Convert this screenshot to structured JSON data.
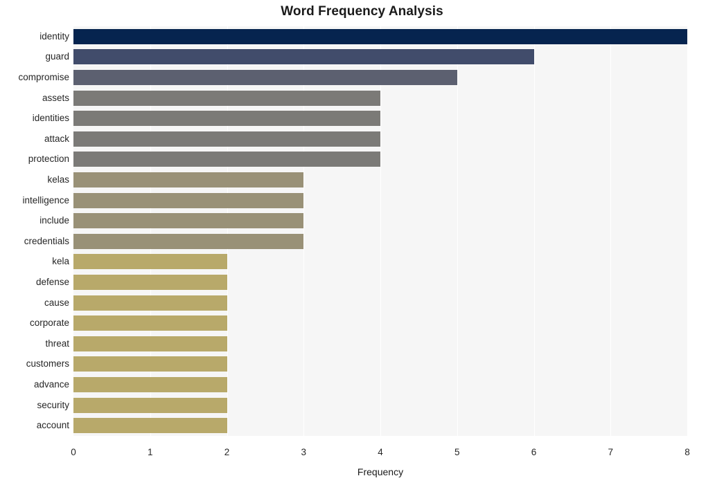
{
  "chart_data": {
    "type": "bar",
    "orientation": "horizontal",
    "title": "Word Frequency Analysis",
    "xlabel": "Frequency",
    "ylabel": "",
    "xlim": [
      0,
      8
    ],
    "ylim": [
      0,
      20
    ],
    "grid": true,
    "legend": null,
    "xticks": [
      "0",
      "1",
      "2",
      "3",
      "4",
      "5",
      "6",
      "7",
      "8"
    ],
    "xtick_values": [
      0,
      1,
      2,
      3,
      4,
      5,
      6,
      7,
      8
    ],
    "categories": [
      "identity",
      "guard",
      "compromise",
      "assets",
      "identities",
      "attack",
      "protection",
      "kelas",
      "intelligence",
      "include",
      "credentials",
      "kela",
      "defense",
      "cause",
      "corporate",
      "threat",
      "customers",
      "advance",
      "security",
      "account"
    ],
    "values": [
      8,
      6,
      5,
      4,
      4,
      4,
      4,
      3,
      3,
      3,
      3,
      2,
      2,
      2,
      2,
      2,
      2,
      2,
      2,
      2
    ],
    "bar_colors": [
      "#06244f",
      "#414c6b",
      "#5c6070",
      "#7b7a77",
      "#7b7a77",
      "#7b7a77",
      "#7b7a77",
      "#999177",
      "#999177",
      "#999177",
      "#999177",
      "#b8a96a",
      "#b8a96a",
      "#b8a96a",
      "#b8a96a",
      "#b8a96a",
      "#b8a96a",
      "#b8a96a",
      "#b8a96a",
      "#b8a96a"
    ],
    "plot_background": "#f6f6f6",
    "figure_background": "#ffffff",
    "gridline_color": "#ffffff"
  }
}
